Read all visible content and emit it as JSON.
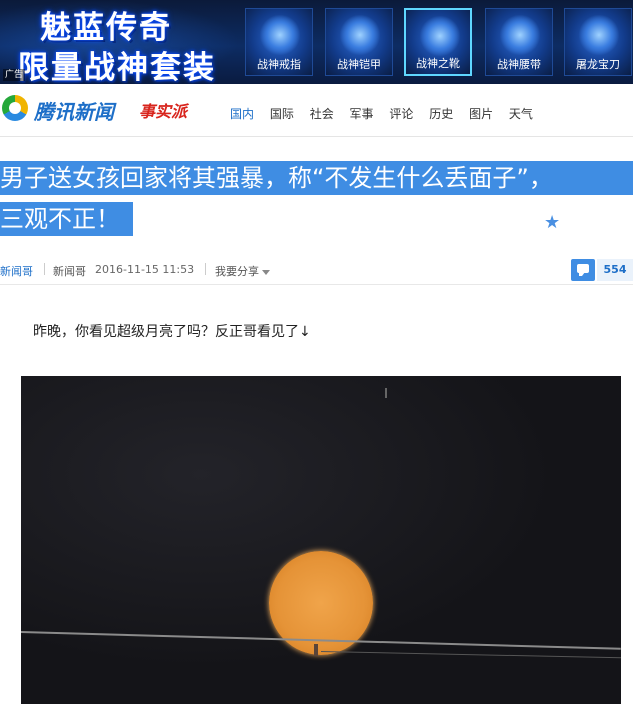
{
  "ad": {
    "line1": "魅蓝传奇",
    "line2": "限量战神套装",
    "mark": "广告",
    "items": [
      {
        "label": "战神戒指"
      },
      {
        "label": "战神铠甲"
      },
      {
        "label": "战神之靴"
      },
      {
        "label": "战神腰带"
      },
      {
        "label": "屠龙宝刀"
      }
    ]
  },
  "header": {
    "logo_text": "腾讯新闻",
    "logo_sub": "事实派",
    "nav": [
      "国内",
      "国际",
      "社会",
      "军事",
      "评论",
      "历史",
      "图片",
      "天气"
    ],
    "active_nav": "国内"
  },
  "article": {
    "title_line1": "男子送女孩回家将其强暴，称“不发生什么丢面子”，",
    "title_line2": "三观不正！",
    "source": "新闻哥",
    "author": "新闻哥",
    "time": "2016-11-15 11:53",
    "share": "我要分享",
    "comment_count": "554",
    "paragraph": "昨晚，你看见超级月亮了吗？反正哥看见了↓"
  },
  "colors": {
    "accent": "#3f8de3",
    "link": "#1e6fc8",
    "logo_red": "#d8241c",
    "moon": "#e59337"
  }
}
